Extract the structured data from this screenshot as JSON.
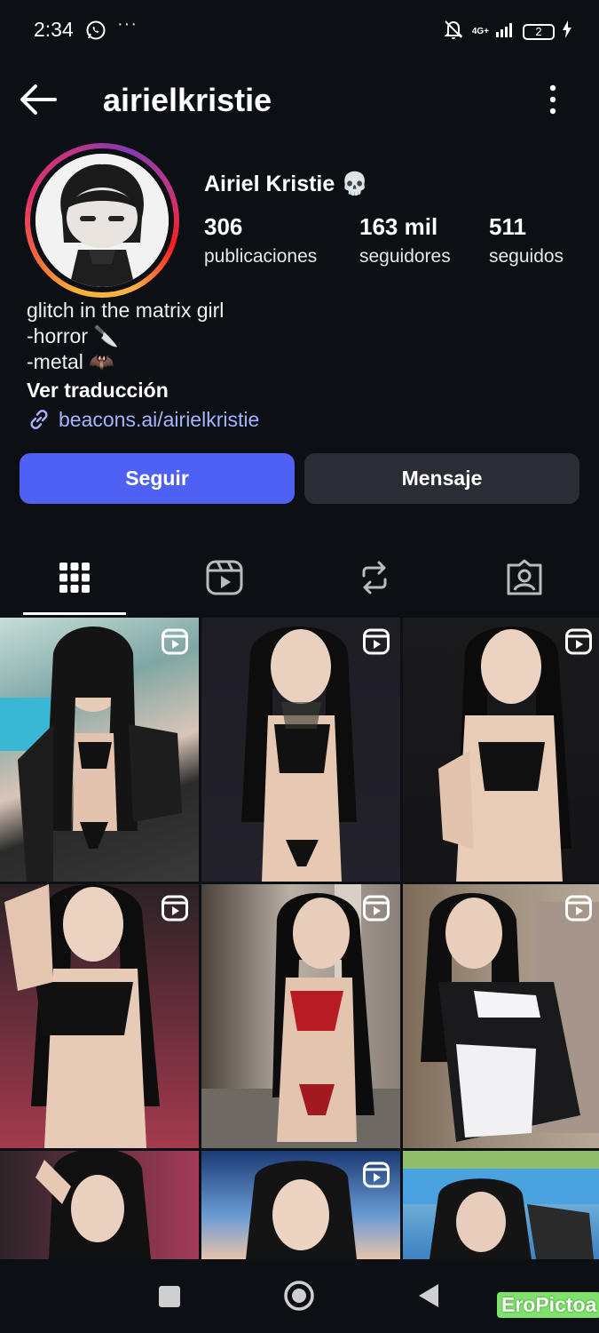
{
  "status_bar": {
    "time": "2:34",
    "network": "4G+",
    "battery": "2"
  },
  "header": {
    "username": "airielkristie"
  },
  "profile": {
    "display_name": "Airiel Kristie",
    "name_emoji": "💀",
    "stats": [
      {
        "value": "306",
        "label": "publicaciones"
      },
      {
        "value": "163 mil",
        "label": "seguidores"
      },
      {
        "value": "511",
        "label": "seguidos"
      }
    ],
    "bio": [
      "glitch in the matrix girl",
      "-horror 🔪",
      "-metal 🦇"
    ],
    "translate_label": "Ver traducción",
    "link": "beacons.ai/airielkristie"
  },
  "actions": {
    "follow": "Seguir",
    "message": "Mensaje"
  },
  "tabs": [
    "grid-icon",
    "reels-icon",
    "reposts-icon",
    "tagged-icon"
  ],
  "grid": {
    "tiles": 9,
    "reel_tiles": [
      1,
      2,
      3,
      4,
      5,
      6,
      8
    ]
  },
  "watermark": "EroPictoa",
  "colors": {
    "accent": "#4f61f2",
    "link": "#a5b4ff",
    "background": "#0c0f14",
    "secondary_button": "#2a2d33"
  }
}
